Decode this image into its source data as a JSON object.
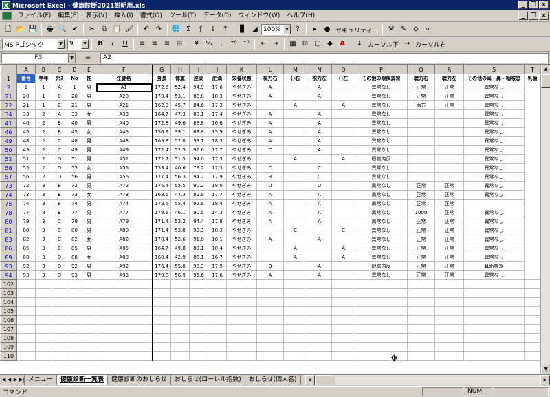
{
  "window": {
    "title": "Microsoft Excel - 健康診断2021説明用.xls",
    "minimize": "_",
    "restore": "❐",
    "close": "×"
  },
  "menu": [
    "ファイル(F)",
    "編集(E)",
    "表示(V)",
    "挿入(I)",
    "書式(O)",
    "ツール(T)",
    "データ(D)",
    "ウィンドウ(W)",
    "ヘルプ(H)"
  ],
  "toolbar1": {
    "zoom": "100%",
    "security": "セキュリティ...",
    "help_icon": "?"
  },
  "toolbar2": {
    "font": "MS Pゴシック",
    "size": "9",
    "bold": "B",
    "italic": "I",
    "underline": "U",
    "percent": "%",
    "comma": ",",
    "cursor_down": "カーソル下",
    "cursor_right": "カーソル右"
  },
  "formula_bar": {
    "cell_ref": "F3",
    "fx": "=",
    "value": "A2"
  },
  "sheet": {
    "columns": [
      "A",
      "B",
      "C",
      "D",
      "E",
      "F",
      "G",
      "H",
      "I",
      "J",
      "K",
      "L",
      "M",
      "N",
      "O",
      "P",
      "Q",
      "R",
      "S",
      "T"
    ],
    "header_row": {
      "row": "1",
      "cells": [
        "番号",
        "学年",
        "ｸﾗｽ",
        "No",
        "性",
        "生徒名",
        "身長",
        "体重",
        "座高",
        "肥満",
        "栄養状態",
        "視力右",
        "()右",
        "視力左",
        "()左",
        "その他の眼疾異常",
        "聴力右",
        "聴力左",
        "その他の耳・鼻・咽喉患",
        "乳歯"
      ]
    },
    "rows": [
      [
        "2",
        "1",
        "1",
        "A",
        "1",
        "男",
        "A1",
        "172.5",
        "52.4",
        "94.9",
        "17.6",
        "やせぎみ",
        "A",
        "",
        "A",
        "",
        "異常なし",
        "正常",
        "正常",
        "異常なし"
      ],
      [
        "21",
        "20",
        "1",
        "C",
        "20",
        "男",
        "A20",
        "170.4",
        "53.1",
        "88.8",
        "18.3",
        "やせぎみ",
        "A",
        "",
        "A",
        "",
        "異常なし",
        "正常",
        "正常",
        "異常なし"
      ],
      [
        "22",
        "21",
        "1",
        "C",
        "21",
        "男",
        "A21",
        "162.3",
        "45.7",
        "84.6",
        "17.3",
        "やせぎみ",
        "",
        "A",
        "",
        "A",
        "異常なし",
        "両方",
        "正常",
        "異常なし"
      ],
      [
        "34",
        "33",
        "2",
        "A",
        "33",
        "女",
        "A33",
        "164.7",
        "47.3",
        "88.1",
        "17.4",
        "やせぎみ",
        "A",
        "",
        "A",
        "",
        "異常なし",
        "",
        "",
        "異常なし"
      ],
      [
        "41",
        "40",
        "2",
        "B",
        "40",
        "男",
        "A40",
        "172.8",
        "49.6",
        "88.8",
        "16.6",
        "やせぎみ",
        "A",
        "",
        "A",
        "",
        "異常なし",
        "",
        "",
        "異常なし"
      ],
      [
        "46",
        "45",
        "2",
        "B",
        "45",
        "女",
        "A45",
        "156.9",
        "39.1",
        "83.8",
        "15.9",
        "やせぎみ",
        "A",
        "",
        "A",
        "",
        "異常なし",
        "",
        "",
        "異常なし"
      ],
      [
        "49",
        "48",
        "2",
        "C",
        "48",
        "男",
        "A48",
        "169.8",
        "52.8",
        "93.1",
        "18.3",
        "やせぎみ",
        "A",
        "",
        "A",
        "",
        "異常なし",
        "",
        "",
        "異常なし"
      ],
      [
        "50",
        "49",
        "2",
        "C",
        "49",
        "男",
        "A49",
        "172.4",
        "52.5",
        "91.6",
        "17.7",
        "やせぎみ",
        "C",
        "",
        "A",
        "",
        "異常なし",
        "",
        "",
        "異常なし"
      ],
      [
        "52",
        "51",
        "2",
        "D",
        "51",
        "男",
        "A51",
        "172.7",
        "51.5",
        "94.0",
        "17.3",
        "やせぎみ",
        "",
        "A",
        "",
        "A",
        "眼瞼内反",
        "",
        "",
        "異常なし"
      ],
      [
        "56",
        "55",
        "2",
        "D",
        "55",
        "女",
        "A55",
        "153.4",
        "40.6",
        "79.2",
        "17.3",
        "やせぎみ",
        "C",
        "",
        "C",
        "",
        "異常なし",
        "",
        "",
        "異常なし"
      ],
      [
        "57",
        "56",
        "2",
        "D",
        "56",
        "男",
        "A56",
        "177.4",
        "56.3",
        "94.2",
        "17.9",
        "やせぎみ",
        "B",
        "",
        "C",
        "",
        "異常なし",
        "",
        "",
        "異常なし"
      ],
      [
        "73",
        "72",
        "3",
        "B",
        "72",
        "男",
        "A72",
        "175.4",
        "55.5",
        "90.2",
        "18.0",
        "やせぎみ",
        "D",
        "",
        "D",
        "",
        "異常なし",
        "正常",
        "正常",
        "異常なし"
      ],
      [
        "74",
        "73",
        "3",
        "B",
        "73",
        "女",
        "A73",
        "163.5",
        "47.3",
        "82.9",
        "17.7",
        "やせぎみ",
        "A",
        "",
        "A",
        "",
        "異常なし",
        "正常",
        "正常",
        "異常なし"
      ],
      [
        "75",
        "74",
        "3",
        "B",
        "74",
        "男",
        "A74",
        "173.5",
        "55.4",
        "92.8",
        "18.4",
        "やせぎみ",
        "A",
        "",
        "A",
        "",
        "異常なし",
        "正常",
        "正常",
        ""
      ],
      [
        "78",
        "77",
        "3",
        "B",
        "77",
        "男",
        "A77",
        "179.5",
        "46.1",
        "90.5",
        "14.3",
        "やせぎみ",
        "A",
        "",
        "A",
        "",
        "異常なし",
        "1000",
        "正常",
        "異常なし"
      ],
      [
        "80",
        "79",
        "3",
        "C",
        "79",
        "男",
        "A79",
        "171.4",
        "52.2",
        "94.4",
        "17.8",
        "やせぎみ",
        "A",
        "",
        "A",
        "",
        "異常なし",
        "正常",
        "正常",
        "異常なし"
      ],
      [
        "81",
        "80",
        "3",
        "C",
        "80",
        "男",
        "A80",
        "171.4",
        "53.8",
        "93.3",
        "18.3",
        "やせぎみ",
        "",
        "C",
        "",
        "C",
        "異常なし",
        "正常",
        "正常",
        "異常なし"
      ],
      [
        "83",
        "82",
        "3",
        "C",
        "82",
        "女",
        "A82",
        "170.4",
        "52.6",
        "91.0",
        "18.1",
        "やせぎみ",
        "A",
        "",
        "A",
        "",
        "異常なし",
        "正常",
        "正常",
        "異常なし"
      ],
      [
        "86",
        "85",
        "3",
        "C",
        "85",
        "男",
        "A85",
        "164.7",
        "49.8",
        "89.1",
        "18.4",
        "やせぎみ",
        "",
        "A",
        "",
        "A",
        "異常なし",
        "正常",
        "正常",
        "異常なし"
      ],
      [
        "89",
        "88",
        "3",
        "D",
        "88",
        "女",
        "A88",
        "160.4",
        "42.9",
        "85.1",
        "16.7",
        "やせぎみ",
        "",
        "A",
        "",
        "A",
        "異常なし",
        "正常",
        "正常",
        "異常なし"
      ],
      [
        "93",
        "92",
        "3",
        "D",
        "92",
        "男",
        "A92",
        "176.4",
        "55.8",
        "93.3",
        "17.9",
        "やせぎみ",
        "B",
        "",
        "A",
        "",
        "眼瞼内反",
        "正常",
        "正常",
        "耳垢栓塞"
      ],
      [
        "94",
        "93",
        "3",
        "D",
        "93",
        "男",
        "A93",
        "179.8",
        "56.9",
        "95.6",
        "17.6",
        "やせぎみ",
        "A",
        "",
        "A",
        "",
        "異常なし",
        "正常",
        "正常",
        "異常なし"
      ]
    ],
    "empty_rows": [
      "102",
      "103",
      "104",
      "105",
      "106",
      "107",
      "108",
      "109",
      "110"
    ]
  },
  "tabs": [
    "メニュー",
    "健康診断一覧表",
    "健康診断のおしらせ",
    "おしらせ(ローレル指数)",
    "おしらせ(個人名)"
  ],
  "status": {
    "mode": "コマンド",
    "num": "NUM"
  }
}
